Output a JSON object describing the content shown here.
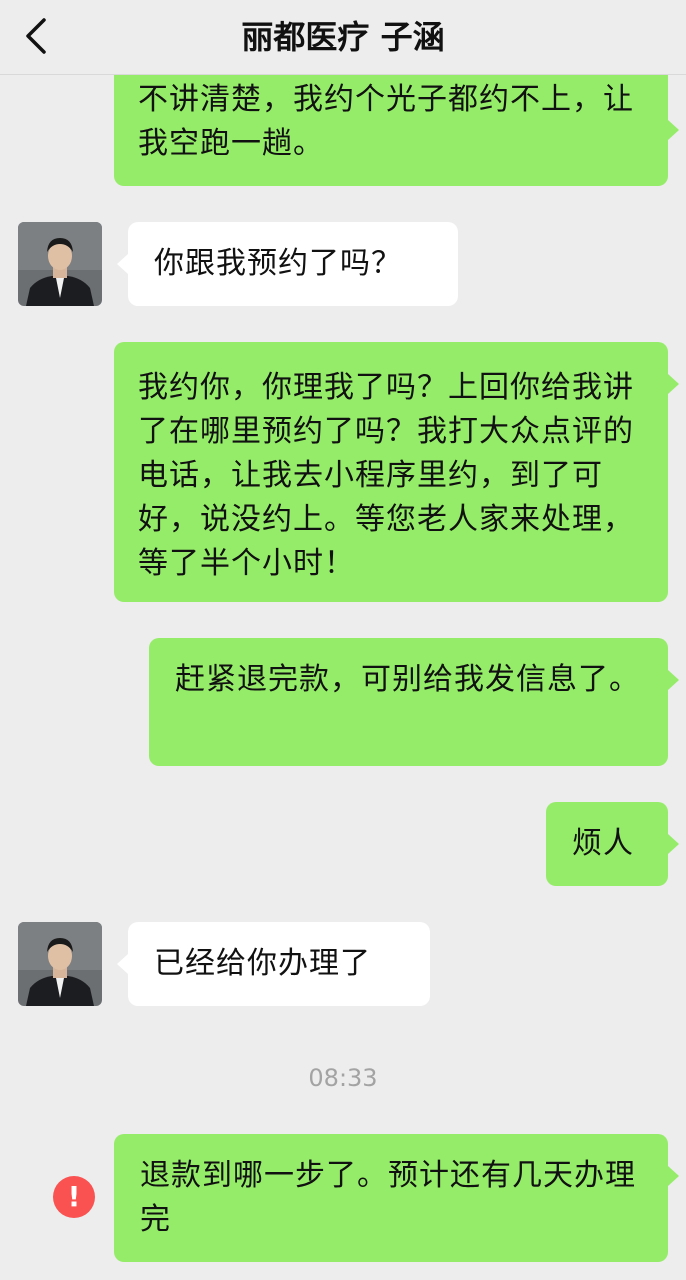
{
  "header": {
    "title": "丽都医疗 子涵",
    "back_icon": "chevron-left-icon"
  },
  "colors": {
    "background": "#ededed",
    "outgoing_bubble": "#95ec69",
    "incoming_bubble": "#ffffff",
    "error_badge": "#fa5151"
  },
  "messages": [
    {
      "direction": "out",
      "text": "不讲清楚，我约个光子都约不上，让我空跑一趟。"
    },
    {
      "direction": "in",
      "text": "你跟我预约了吗？"
    },
    {
      "direction": "out",
      "text": "我约你，你理我了吗？上回你给我讲了在哪里预约了吗？我打大众点评的电话，让我去小程序里约，到了可好，说没约上。等您老人家来处理，等了半个小时！"
    },
    {
      "direction": "out",
      "text": "赶紧退完款，可别给我发信息了。"
    },
    {
      "direction": "out",
      "text": "烦人"
    },
    {
      "direction": "in",
      "text": "已经给你办理了"
    },
    {
      "direction": "out",
      "text": "退款到哪一步了。预计还有几天办理完",
      "failed": true,
      "failed_icon": "!"
    }
  ],
  "timestamp": "08:33"
}
